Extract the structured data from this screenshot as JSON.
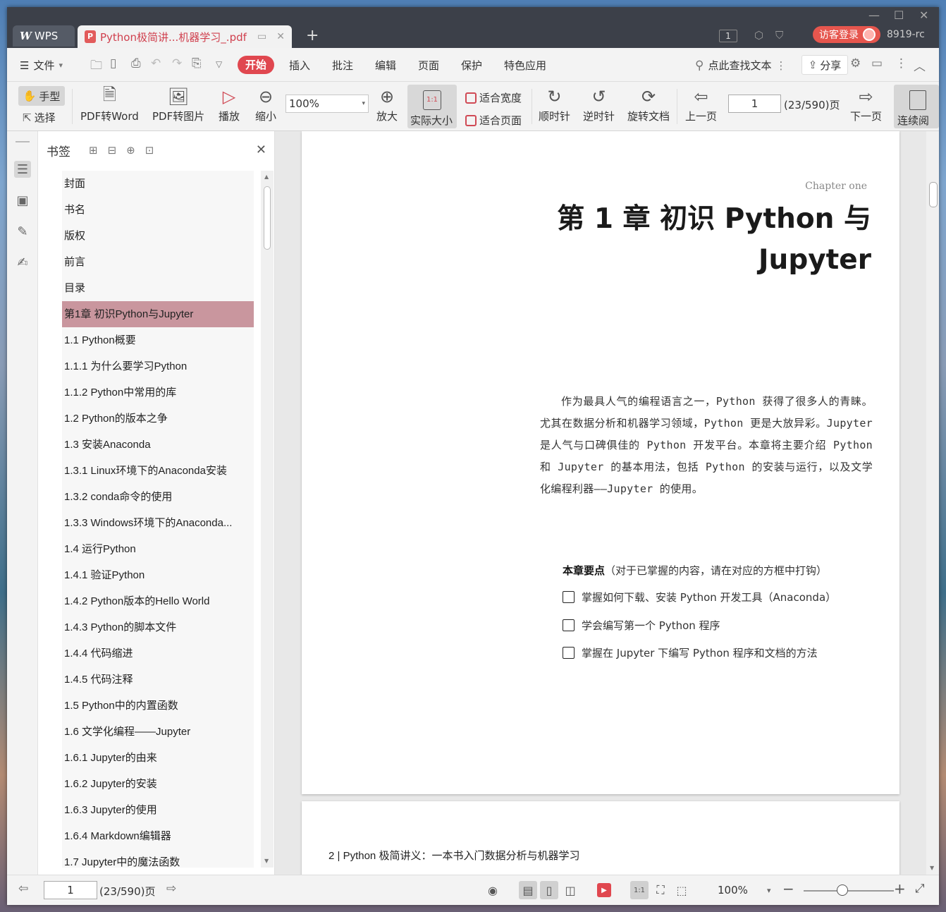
{
  "titlebar": {
    "app_label": "WPS",
    "doc_tab_title": "Python极简讲...机器学习_.pdf",
    "page_indicator": "1",
    "guest_login": "访客登录",
    "user_name": "8919-rc"
  },
  "menubar": {
    "file": "文件",
    "items": [
      "开始",
      "插入",
      "批注",
      "编辑",
      "页面",
      "保护",
      "特色应用"
    ],
    "search": "点此查找文本",
    "share": "分享"
  },
  "toolbar": {
    "hand": "手型",
    "select": "选择",
    "pdf_to_word": "PDF转Word",
    "pdf_to_image": "PDF转图片",
    "play": "播放",
    "zoom_out": "缩小",
    "zoom_value": "100%",
    "zoom_in": "放大",
    "actual_size": "实际大小",
    "actual_icon_text": "1:1",
    "fit_width": "适合宽度",
    "fit_page": "适合页面",
    "clockwise": "顺时针",
    "counterclockwise": "逆时针",
    "rotate_doc": "旋转文档",
    "prev_page": "上一页",
    "page_input": "1",
    "page_total": "(23/590)页",
    "next_page": "下一页",
    "continuous": "连续阅"
  },
  "bookmarks": {
    "title": "书签",
    "items": [
      "封面",
      "书名",
      "版权",
      "前言",
      "目录",
      "第1章  初识Python与Jupyter",
      "1.1  Python概要",
      "1.1.1  为什么要学习Python",
      "1.1.2  Python中常用的库",
      "1.2  Python的版本之争",
      "1.3  安装Anaconda",
      "1.3.1  Linux环境下的Anaconda安装",
      "1.3.2  conda命令的使用",
      "1.3.3  Windows环境下的Anaconda...",
      "1.4  运行Python",
      "1.4.1  验证Python",
      "1.4.2  Python版本的Hello World",
      "1.4.3  Python的脚本文件",
      "1.4.4  代码缩进",
      "1.4.5  代码注释",
      "1.5  Python中的内置函数",
      "1.6  文学化编程——Jupyter",
      "1.6.1  Jupyter的由来",
      "1.6.2  Jupyter的安装",
      "1.6.3  Jupyter的使用",
      "1.6.4  Markdown编辑器",
      "1.7  Jupyter中的魔法函数"
    ],
    "selected_index": 5
  },
  "document": {
    "chapter_en": "Chapter one",
    "chapter_title_line1": "第 1 章   初识 Python 与",
    "chapter_title_line2": "Jupyter",
    "intro": "作为最具人气的编程语言之一，Python 获得了很多人的青睐。尤其在数据分析和机器学习领域，Python 更是大放异彩。Jupyter 是人气与口碑俱佳的 Python 开发平台。本章将主要介绍 Python 和 Jupyter 的基本用法，包括 Python 的安装与运行，以及文学化编程利器——Jupyter 的使用。",
    "key_points_label": "本章要点",
    "key_points_hint": "（对于已掌握的内容，请在对应的方框中打钩）",
    "checklist": [
      "掌握如何下载、安装 Python 开发工具（Anaconda）",
      "学会编写第一个 Python 程序",
      "掌握在 Jupyter 下编写 Python 程序和文档的方法"
    ],
    "page2_footer": "2   |   Python 极简讲义：一本书入门数据分析与机器学习"
  },
  "statusbar": {
    "page_input": "1",
    "page_total": "(23/590)页",
    "zoom": "100%"
  }
}
